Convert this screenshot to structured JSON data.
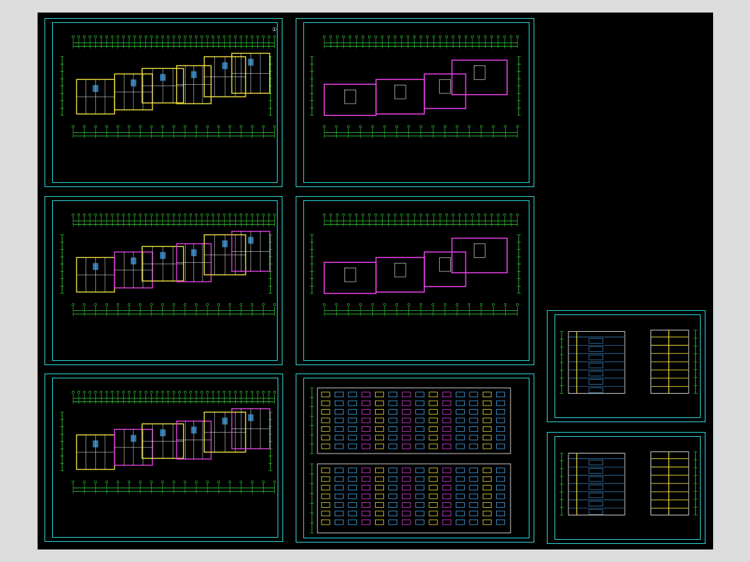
{
  "colors": {
    "background": "#000000",
    "frame": "#2fd8d8",
    "dimension": "#37d83a",
    "wall": "#f0e040",
    "wall_alt": "#e040e0",
    "fixture": "#48a8f0",
    "text": "#e8e8e8",
    "window_frame": "#ffffff"
  },
  "sheets": [
    {
      "id": "plan-ground",
      "kind": "plan",
      "caption": "",
      "marker": "①"
    },
    {
      "id": "plan-roof",
      "kind": "plan",
      "caption": ""
    },
    {
      "id": "plan-typical",
      "kind": "plan",
      "caption": ""
    },
    {
      "id": "plan-attic",
      "kind": "plan",
      "caption": ""
    },
    {
      "id": "plan-upper",
      "kind": "plan",
      "caption": ""
    },
    {
      "id": "elevations-front-back",
      "kind": "elevation",
      "caption": ""
    },
    {
      "id": "elevation-sections-a",
      "kind": "section",
      "caption": ""
    },
    {
      "id": "elevation-sections-b",
      "kind": "section",
      "caption": ""
    }
  ]
}
